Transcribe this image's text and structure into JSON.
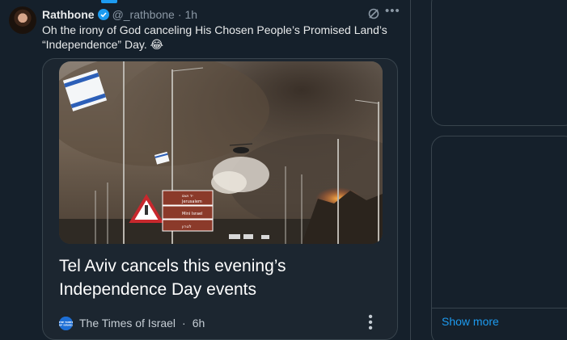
{
  "tweet": {
    "display_name": "Rathbone",
    "handle": "@_rathbone",
    "separator": "·",
    "time": "1h",
    "text": "Oh the irony of God canceling His Chosen People’s Promised Land’s “Independence” Day. 😂",
    "card": {
      "title": "Tel Aviv cancels this evening’s Independence Day events",
      "source": "The Times of Israel",
      "source_separator": "·",
      "source_time": "6h",
      "logo_text": "THE TIMES OF ISRAEL",
      "image": {
        "road_sign_lines": [
          "יד ושם",
          "Jerusalem",
          "Mini Israel",
          "לטרון"
        ]
      }
    }
  },
  "sidebar": {
    "show_more": "Show more"
  },
  "colors": {
    "background": "#15202b",
    "accent": "#1d9bf0",
    "border": "#38444d",
    "secondary_text": "#8b98a5"
  },
  "icons": {
    "verified": "verified-badge-icon",
    "grok": "grok-icon",
    "more": "more-horizontal-icon",
    "card_more": "more-vertical-icon"
  }
}
